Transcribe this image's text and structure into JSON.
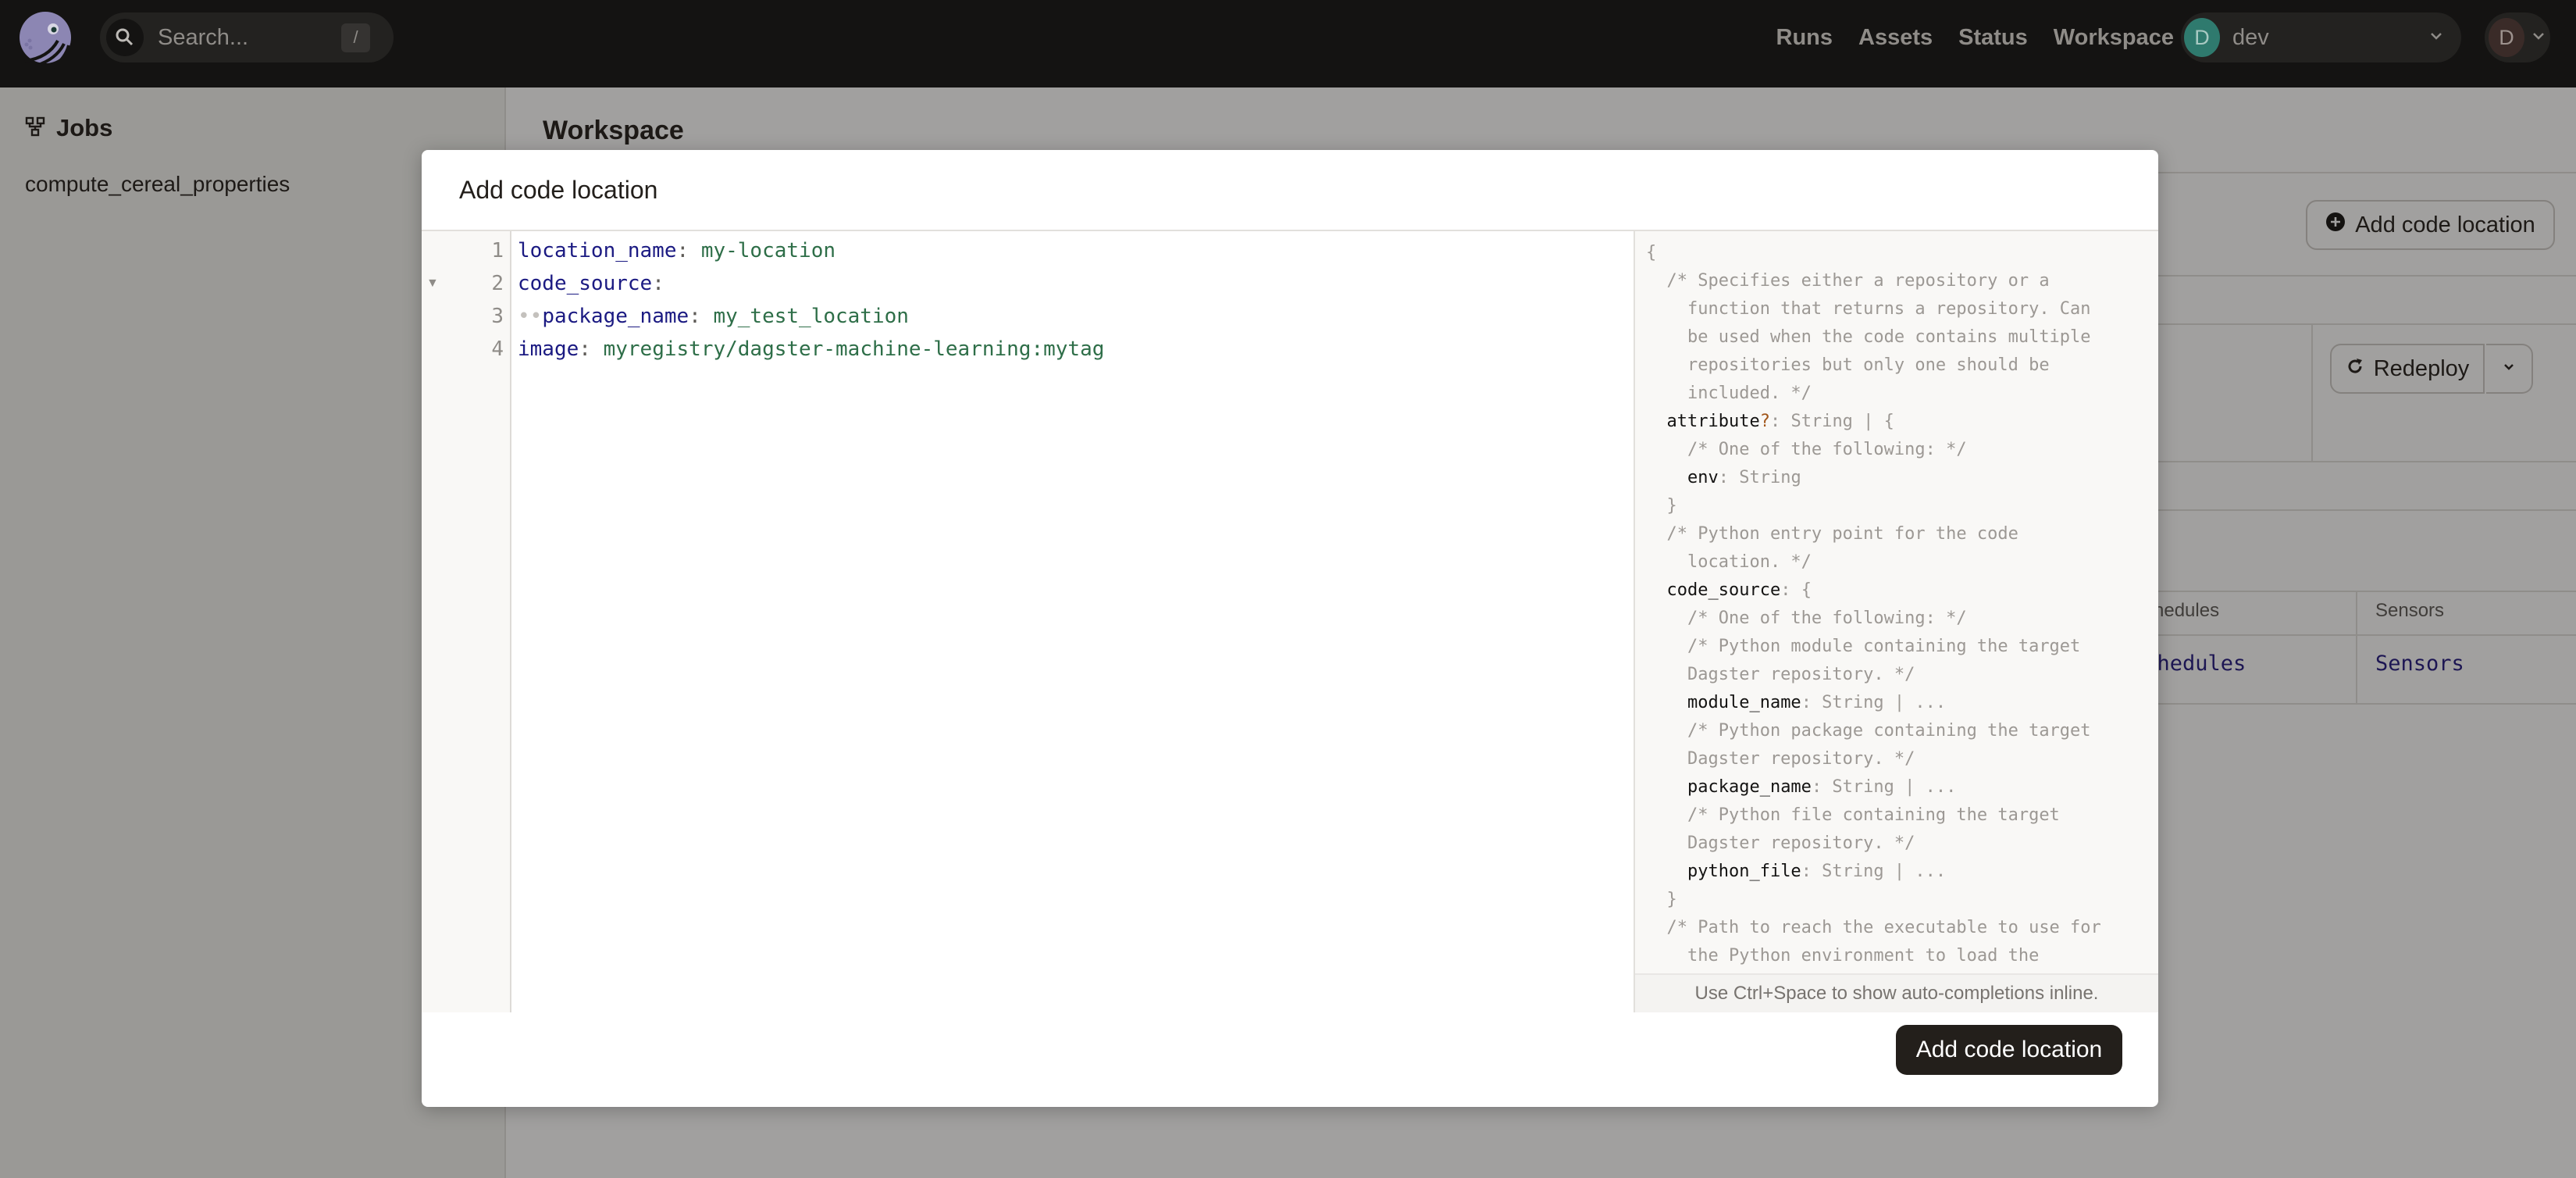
{
  "topnav": {
    "search_placeholder": "Search...",
    "search_shortcut": "/",
    "links": [
      "Runs",
      "Assets",
      "Status",
      "Workspace"
    ],
    "deployment": {
      "avatar_letter": "D",
      "name": "dev",
      "avatar_color": "#2f7a6e"
    },
    "user": {
      "avatar_letter": "D",
      "avatar_color": "#3a2b28"
    }
  },
  "left_panel": {
    "title": "Jobs",
    "items": [
      "compute_cereal_properties"
    ]
  },
  "main": {
    "title": "Workspace",
    "add_location_label": "Add code location",
    "redeploy_label": "Redeploy",
    "table_headers": [
      "Schedules",
      "Sensors"
    ],
    "table_links": [
      "Schedules",
      "Sensors"
    ]
  },
  "modal": {
    "title": "Add code location",
    "editor_lines": [
      {
        "num": "1",
        "key": "location_name",
        "value": "my-location",
        "indent": ""
      },
      {
        "num": "2",
        "key": "code_source",
        "value": "",
        "indent": ""
      },
      {
        "num": "3",
        "key": "package_name",
        "value": "my_test_location",
        "indent": "••"
      },
      {
        "num": "4",
        "key": "image",
        "value": "myregistry/dagster-machine-learning:mytag",
        "indent": ""
      }
    ],
    "schema_lines": [
      "{",
      "  /* Specifies either a repository or a",
      "    function that returns a repository. Can",
      "    be used when the code contains multiple",
      "    repositories but only one should be",
      "    included. */",
      "  attribute?: String | {",
      "    /* One of the following: */",
      "    env: String",
      "  }",
      "  /* Python entry point for the code",
      "    location. */",
      "  code_source: {",
      "    /* One of the following: */",
      "    /* Python module containing the target",
      "    Dagster repository. */",
      "    module_name: String | ...",
      "    /* Python package containing the target",
      "    Dagster repository. */",
      "    package_name: String | ...",
      "    /* Python file containing the target",
      "    Dagster repository. */",
      "    python_file: String | ...",
      "  }",
      "  /* Path to reach the executable to use for",
      "    the Python environment to load the"
    ],
    "schema_hint": "Use Ctrl+Space to show auto-completions inline.",
    "submit_label": "Add code location"
  }
}
